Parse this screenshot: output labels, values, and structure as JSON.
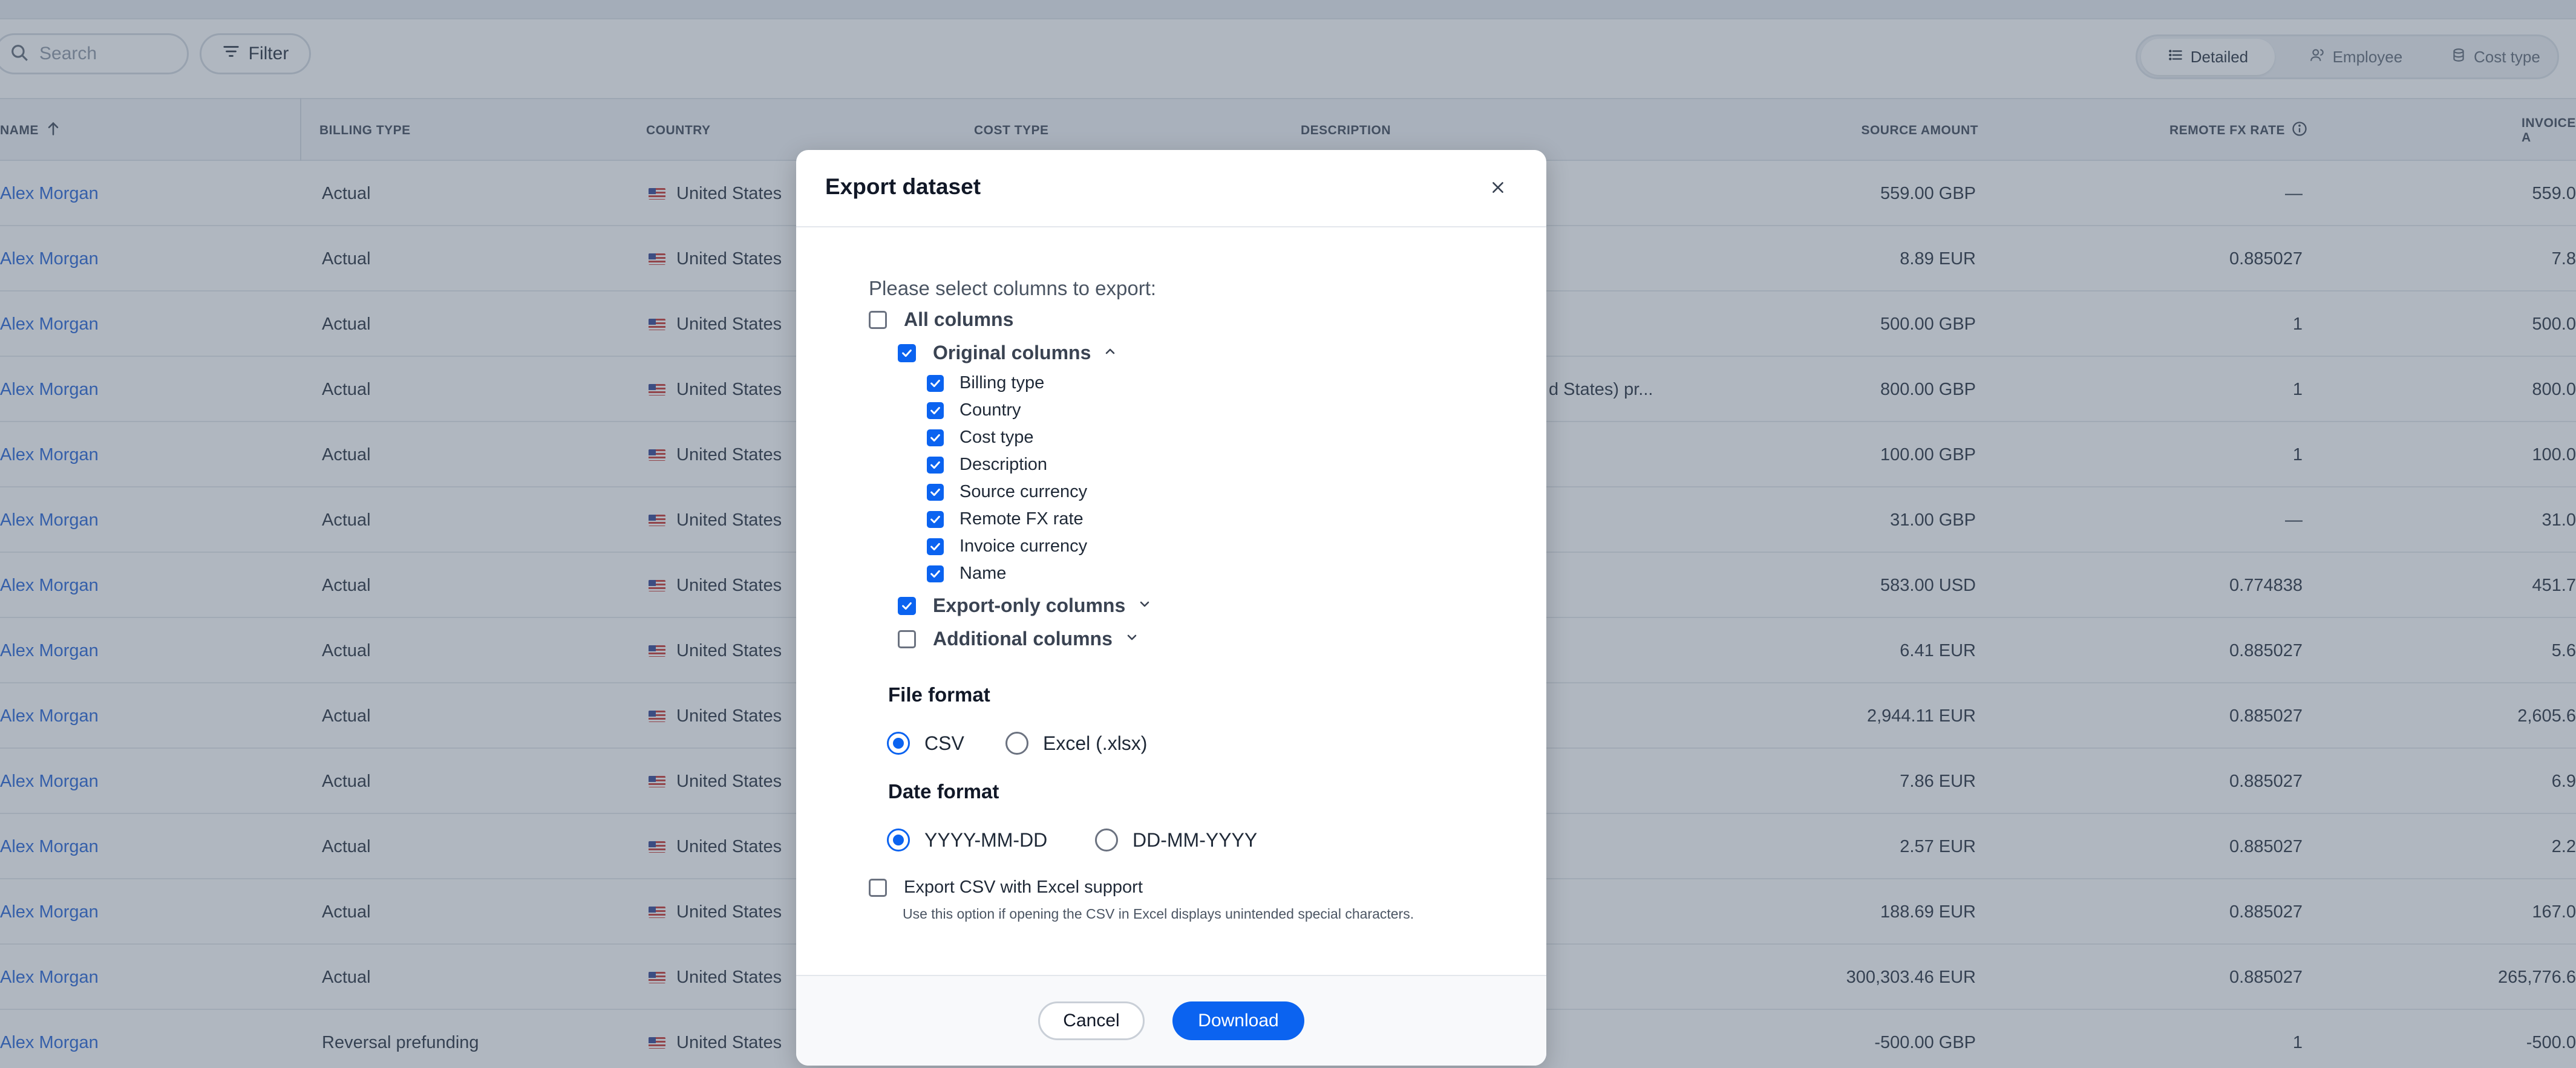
{
  "toolbar": {
    "search_placeholder": "Search",
    "filter_label": "Filter",
    "views": [
      "Detailed",
      "Employee",
      "Cost type"
    ],
    "active_view": "Detailed"
  },
  "table": {
    "headers": {
      "name": "NAME",
      "billing_type": "BILLING TYPE",
      "country": "COUNTRY",
      "cost_type": "COST TYPE",
      "description": "DESCRIPTION",
      "source_amount": "SOURCE AMOUNT",
      "remote_fx_rate": "REMOTE FX RATE",
      "invoice_amount": "INVOICE A"
    },
    "rows": [
      {
        "name": "Alex Morgan",
        "billing": "Actual",
        "country": "United States",
        "desc": "",
        "amount": "559.00 GBP",
        "fx": "—",
        "invoice": "559.0"
      },
      {
        "name": "Alex Morgan",
        "billing": "Actual",
        "country": "United States",
        "desc": "",
        "amount": "8.89 EUR",
        "fx": "0.885027",
        "invoice": "7.8"
      },
      {
        "name": "Alex Morgan",
        "billing": "Actual",
        "country": "United States",
        "desc": "",
        "amount": "500.00 GBP",
        "fx": "1",
        "invoice": "500.0"
      },
      {
        "name": "Alex Morgan",
        "billing": "Actual",
        "country": "United States",
        "desc": "d States) pr...",
        "amount": "800.00 GBP",
        "fx": "1",
        "invoice": "800.0"
      },
      {
        "name": "Alex Morgan",
        "billing": "Actual",
        "country": "United States",
        "desc": "",
        "amount": "100.00 GBP",
        "fx": "1",
        "invoice": "100.0"
      },
      {
        "name": "Alex Morgan",
        "billing": "Actual",
        "country": "United States",
        "desc": "",
        "amount": "31.00 GBP",
        "fx": "—",
        "invoice": "31.0"
      },
      {
        "name": "Alex Morgan",
        "billing": "Actual",
        "country": "United States",
        "desc": "",
        "amount": "583.00 USD",
        "fx": "0.774838",
        "invoice": "451.7"
      },
      {
        "name": "Alex Morgan",
        "billing": "Actual",
        "country": "United States",
        "desc": "",
        "amount": "6.41 EUR",
        "fx": "0.885027",
        "invoice": "5.6"
      },
      {
        "name": "Alex Morgan",
        "billing": "Actual",
        "country": "United States",
        "desc": "",
        "amount": "2,944.11 EUR",
        "fx": "0.885027",
        "invoice": "2,605.6"
      },
      {
        "name": "Alex Morgan",
        "billing": "Actual",
        "country": "United States",
        "desc": "",
        "amount": "7.86 EUR",
        "fx": "0.885027",
        "invoice": "6.9"
      },
      {
        "name": "Alex Morgan",
        "billing": "Actual",
        "country": "United States",
        "desc": "",
        "amount": "2.57 EUR",
        "fx": "0.885027",
        "invoice": "2.2"
      },
      {
        "name": "Alex Morgan",
        "billing": "Actual",
        "country": "United States",
        "desc": "",
        "amount": "188.69 EUR",
        "fx": "0.885027",
        "invoice": "167.0"
      },
      {
        "name": "Alex Morgan",
        "billing": "Actual",
        "country": "United States",
        "desc": "",
        "amount": "300,303.46 EUR",
        "fx": "0.885027",
        "invoice": "265,776.6"
      },
      {
        "name": "Alex Morgan",
        "billing": "Reversal prefunding",
        "country": "United States",
        "desc": "",
        "amount": "-500.00 GBP",
        "fx": "1",
        "invoice": "-500.0"
      }
    ]
  },
  "modal": {
    "title": "Export dataset",
    "prompt": "Please select columns to export:",
    "all_columns": {
      "label": "All columns",
      "checked": false
    },
    "original_columns": {
      "label": "Original columns",
      "checked": true,
      "expanded": true
    },
    "original_items": [
      {
        "label": "Billing type",
        "checked": true
      },
      {
        "label": "Country",
        "checked": true
      },
      {
        "label": "Cost type",
        "checked": true
      },
      {
        "label": "Description",
        "checked": true
      },
      {
        "label": "Source currency",
        "checked": true
      },
      {
        "label": "Remote FX rate",
        "checked": true
      },
      {
        "label": "Invoice currency",
        "checked": true
      },
      {
        "label": "Name",
        "checked": true
      }
    ],
    "export_only_columns": {
      "label": "Export-only columns",
      "checked": true,
      "expanded": false
    },
    "additional_columns": {
      "label": "Additional columns",
      "checked": false,
      "expanded": false
    },
    "file_format": {
      "title": "File format",
      "options": [
        "CSV",
        "Excel (.xlsx)"
      ],
      "selected": "CSV"
    },
    "date_format": {
      "title": "Date format",
      "options": [
        "YYYY-MM-DD",
        "DD-MM-YYYY"
      ],
      "selected": "YYYY-MM-DD"
    },
    "excel_support": {
      "label": "Export CSV with Excel support",
      "helper": "Use this option if opening the CSV in Excel displays unintended special characters.",
      "checked": false
    },
    "cancel_label": "Cancel",
    "download_label": "Download"
  },
  "colors": {
    "accent": "#0b63f0",
    "link": "#1f5fd6",
    "overlay": "rgba(80,95,115,0.45)"
  }
}
